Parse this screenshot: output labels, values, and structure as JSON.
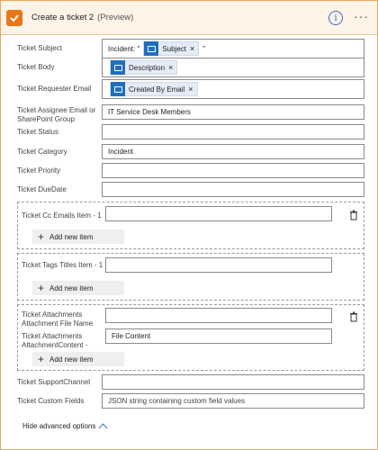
{
  "header": {
    "title": "Create a ticket 2",
    "preview": "(Preview)",
    "info_symbol": "i",
    "more_symbol": "···"
  },
  "fields": {
    "subject": {
      "label": "Ticket Subject",
      "prefix": "Incident: \"",
      "token": "Subject",
      "suffix": "\""
    },
    "body": {
      "label": "Ticket Body",
      "token": "Description"
    },
    "requester": {
      "label": "Ticket Requester Email",
      "token": "Created By Email"
    },
    "assignee": {
      "label": "Ticket Assignee Email or SharePoint Group",
      "value": "IT Service Desk Members"
    },
    "status": {
      "label": "Ticket Status",
      "value": ""
    },
    "category": {
      "label": "Ticket Category",
      "value": "Incident"
    },
    "priority": {
      "label": "Ticket Priority",
      "value": ""
    },
    "duedate": {
      "label": "Ticket DueDate",
      "value": ""
    },
    "cc": {
      "label": "Ticket Cc Emails Item - 1",
      "value": ""
    },
    "tags": {
      "label": "Ticket Tags Titles Item - 1",
      "value": ""
    },
    "att_name": {
      "label": "Ticket Attachments Attachment File Name",
      "value": ""
    },
    "att_content": {
      "label": "Ticket Attachments AttachmentContent -",
      "value": "File Content"
    },
    "channel": {
      "label": "Ticket SupportChannel",
      "value": ""
    },
    "custom": {
      "label": "Ticket Custom Fields",
      "value": "JSON string containing custom field values"
    }
  },
  "token_remove": "×",
  "add_new_item": "Add new item",
  "add_plus": "+",
  "hide_advanced": "Hide advanced options",
  "colors": {
    "accent": "#e8761b",
    "token_icon": "#1f6fbf",
    "link": "#3b6fc4"
  }
}
